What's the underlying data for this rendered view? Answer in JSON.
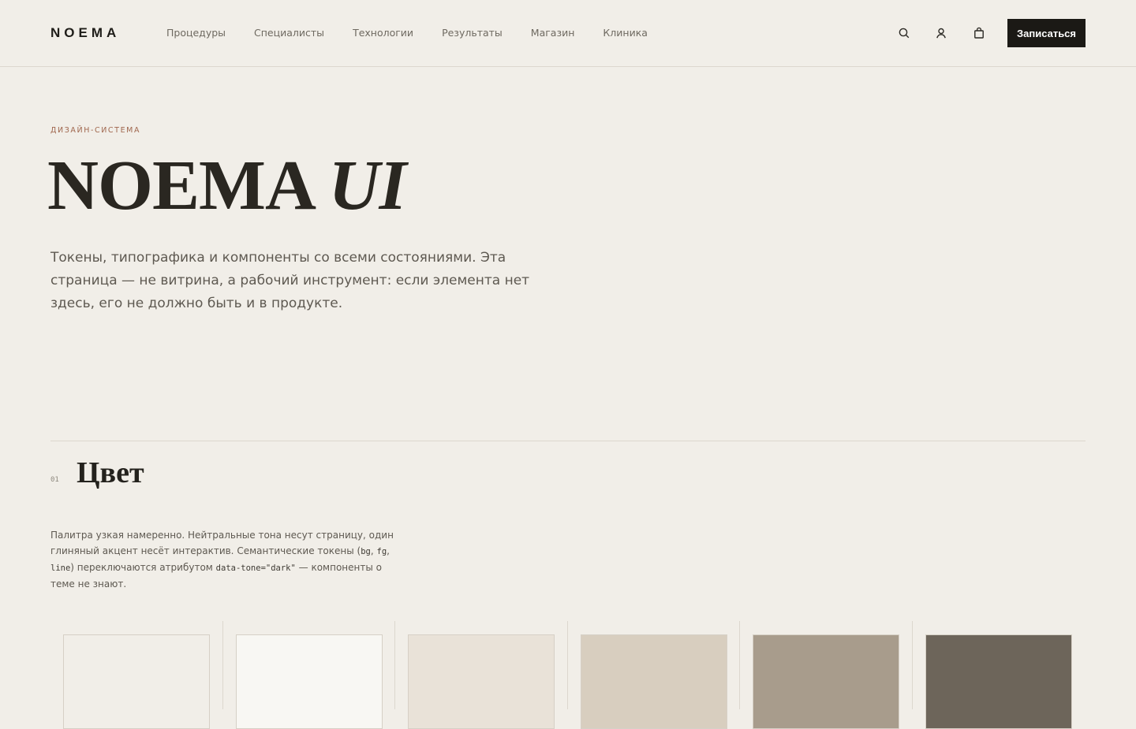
{
  "header": {
    "logo": "NOEMA",
    "nav": [
      "Процедуры",
      "Специалисты",
      "Технологии",
      "Результаты",
      "Магазин",
      "Клиника"
    ],
    "icons": [
      "search-icon",
      "user-icon",
      "bag-icon"
    ],
    "cta": "Записаться"
  },
  "hero": {
    "eyebrow": "ДИЗАЙН-СИСТЕМА",
    "title_main": "NOEMA",
    "title_italic": "UI",
    "lead": "Токены, типографика и компоненты со всеми состояниями. Эта страница — не витрина, а рабочий инструмент: если элемента нет здесь, его не должно быть и в продукте."
  },
  "section_color": {
    "number": "01",
    "title": "Цвет",
    "desc_parts": {
      "p1": "Палитра узкая намеренно. Нейтральные тона несут страницу, один глиняный акцент несёт интерактив. Семантические токены (",
      "code1": "bg",
      "sep1": ", ",
      "code2": "fg",
      "sep2": ", ",
      "code3": "line",
      "p2": ") переключаются атрибутом ",
      "code4": "data-tone=\"dark\"",
      "p3": " — компоненты о теме не знают."
    },
    "swatches": [
      "#f1eee8",
      "#f8f7f3",
      "#e9e2d8",
      "#d8cebf",
      "#a89c8c",
      "#6d655a"
    ]
  },
  "colors": {
    "background": "#f1eee8",
    "accent": "#a0674e",
    "cta_bg": "#1b1915",
    "line": "#dcd7ce"
  }
}
